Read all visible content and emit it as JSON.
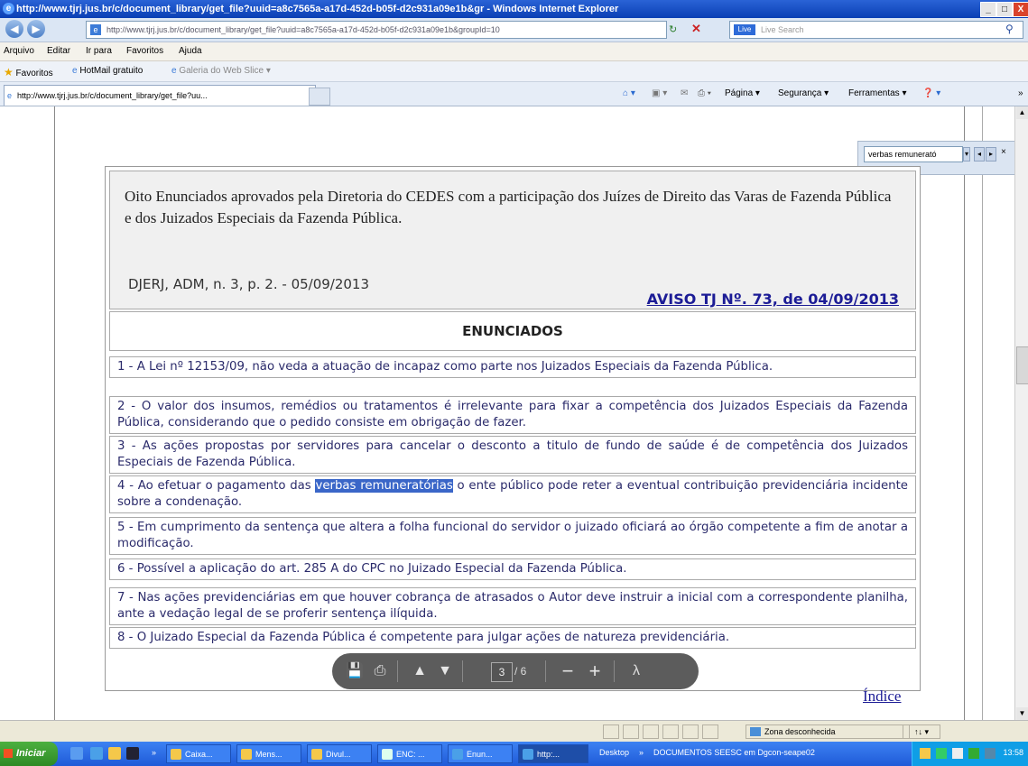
{
  "window": {
    "title": "http://www.tjrj.jus.br/c/document_library/get_file?uuid=a8c7565a-a17d-452d-b05f-d2c931a09e1b&gr - Windows Internet Explorer",
    "min": "_",
    "max": "□",
    "close": "X"
  },
  "address": {
    "url": "http://www.tjrj.jus.br/c/document_library/get_file?uuid=a8c7565a-a17d-452d-b05f-d2c931a09e1b&groupId=10",
    "search_placeholder": "Live Search",
    "search_logo": "Live"
  },
  "menu": [
    "Arquivo",
    "Editar",
    "Ir para",
    "Favoritos",
    "Ajuda"
  ],
  "favorites": {
    "label": "Favoritos",
    "items": [
      "HotMail gratuito",
      "Galeria do Web Slice"
    ]
  },
  "tab": {
    "title": "http://www.tjrj.jus.br/c/document_library/get_file?uu..."
  },
  "toolbar": {
    "page": "Página",
    "security": "Segurança",
    "tools": "Ferramentas"
  },
  "find": {
    "text": "verbas remunerató"
  },
  "document": {
    "header_text": "Oito Enunciados aprovados pela Diretoria do CEDES com a participação dos Juízes de Direito das Varas de Fazenda Pública e dos Juizados Especiais da Fazenda Pública.",
    "djerj": "DJERJ, ADM, n. 3, p. 2.  - 05/09/2013",
    "aviso": "AVISO TJ Nº. 73, de 04/09/2013",
    "section_title": "ENUNCIADOS",
    "items": [
      "1 - A Lei nº 12153/09, não veda a atuação de incapaz como parte nos Juizados Especiais da Fazenda Pública.",
      "2 - O valor dos insumos, remédios ou tratamentos é irrelevante para fixar a competência dos Juizados Especiais da Fazenda Pública, considerando que o pedido consiste em obrigação de fazer.",
      "3 - As ações propostas por servidores para cancelar o desconto a titulo de fundo de saúde é de competência dos Juizados Especiais de Fazenda Pública.",
      "6 - Possível a aplicação do art. 285 A do CPC no Juizado Especial da Fazenda Pública.",
      "7 - Nas ações previdenciárias em que houver cobrança de atrasados o Autor deve instruir a inicial com a correspondente planilha, ante a vedação legal de se proferir sentença ilíquida.",
      "8 - O Juizado Especial da Fazenda Pública é competente para julgar ações de natureza previdenciária."
    ],
    "item4_pre": "4 - Ao efetuar o pagamento das ",
    "item4_hl": "verbas remuneratórias",
    "item4_post": " o ente público pode reter a eventual contribuição previdenciária incidente sobre a condenação.",
    "item5": "5 - Em cumprimento da sentença que altera a folha funcional do servidor o juizado oficiará ao órgão competente a fim de anotar a modificação.",
    "index_link": "Índice"
  },
  "pdf_toolbar": {
    "current_page": "3",
    "total": "/ 6"
  },
  "status": {
    "zone": "Zona desconhecida",
    "zoom": "↑↓ ▾"
  },
  "taskbar": {
    "start": "Iniciar",
    "buttons": [
      "Caixa...",
      "Mens...",
      "Divul...",
      "ENC: ...",
      "Enun...",
      "http:..."
    ],
    "desktop": "Desktop",
    "documentos": "DOCUMENTOS SEESC em Dgcon-seape02",
    "time": "13:58"
  }
}
